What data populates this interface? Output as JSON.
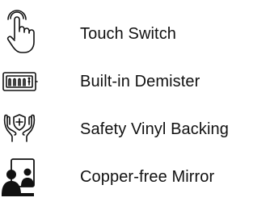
{
  "features": [
    {
      "icon": "touch-switch-icon",
      "label": "Touch Switch"
    },
    {
      "icon": "demister-icon",
      "label": "Built-in Demister"
    },
    {
      "icon": "safety-hands-icon",
      "label": "Safety Vinyl Backing"
    },
    {
      "icon": "copper-free-mirror-icon",
      "label": "Copper-free Mirror"
    }
  ],
  "colors": {
    "text": "#111111",
    "icon": "#111111"
  }
}
